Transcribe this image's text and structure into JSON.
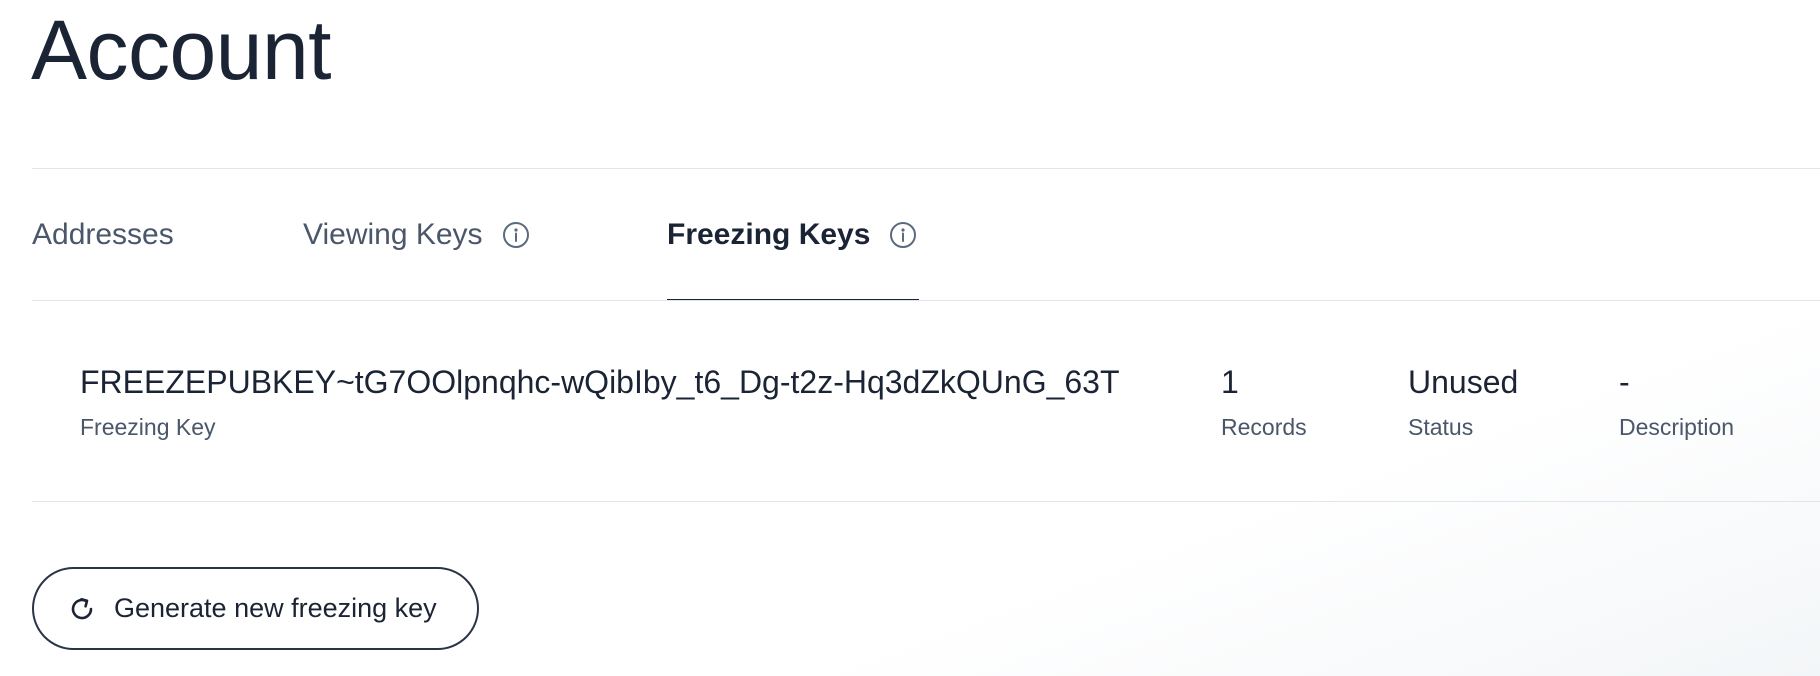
{
  "page": {
    "title": "Account"
  },
  "tabs": [
    {
      "label": "Addresses",
      "active": false,
      "has_info_icon": false
    },
    {
      "label": "Viewing Keys",
      "active": false,
      "has_info_icon": true
    },
    {
      "label": "Freezing Keys",
      "active": true,
      "has_info_icon": true
    }
  ],
  "freezing_key": {
    "key_value": "FREEZEPUBKEY~tG7OOlpnqhc-wQibIby_t6_Dg-t2z-Hq3dZkQUnG_63T",
    "key_label": "Freezing Key",
    "records_value": "1",
    "records_label": "Records",
    "status_value": "Unused",
    "status_label": "Status",
    "description_value": "-",
    "description_label": "Description"
  },
  "actions": {
    "generate_label": "Generate new freezing key"
  },
  "icons": {
    "info": "info-circle-icon",
    "refresh": "refresh-icon"
  },
  "colors": {
    "text_primary": "#1b2434",
    "text_secondary": "#4a5669",
    "divider": "#e1e6ec",
    "icon": "#5b6b7f"
  }
}
